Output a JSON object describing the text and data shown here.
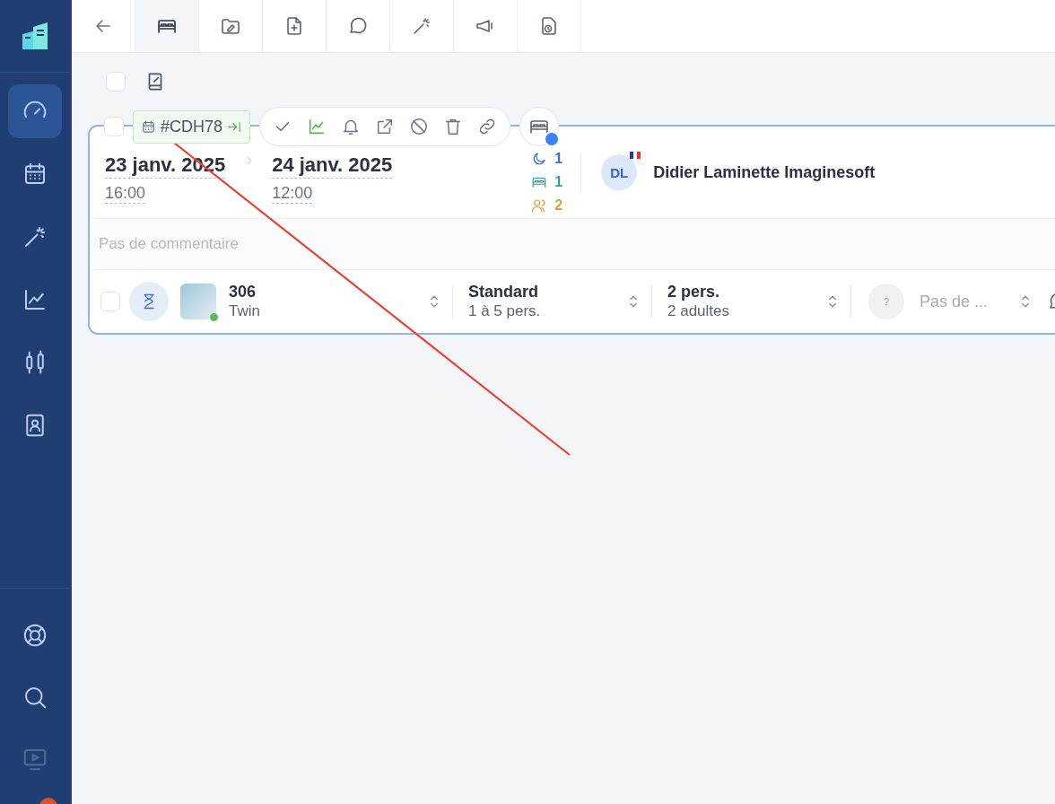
{
  "sidebar": {
    "items": [
      {
        "selected": true,
        "disabled": false
      },
      {
        "selected": false,
        "disabled": false
      },
      {
        "selected": false,
        "disabled": false
      },
      {
        "selected": false,
        "disabled": false
      },
      {
        "selected": false,
        "disabled": false
      },
      {
        "selected": false,
        "disabled": false
      }
    ],
    "bottom_items": [
      {
        "disabled": false
      },
      {
        "disabled": false
      },
      {
        "disabled": true
      }
    ]
  },
  "tabs": [
    {
      "selected": true
    },
    {
      "selected": false
    },
    {
      "selected": false
    },
    {
      "selected": false
    },
    {
      "selected": false
    },
    {
      "selected": false
    },
    {
      "selected": false
    }
  ],
  "toolbar": {
    "select_all_checked": false
  },
  "booking": {
    "checked": false,
    "reference": "#CDH78",
    "arrival": {
      "date": "23 janv. 2025",
      "time": "16:00"
    },
    "departure": {
      "date": "24 janv. 2025",
      "time": "12:00"
    },
    "nights": "1",
    "rooms": "1",
    "guests": "2",
    "guest": {
      "initials": "DL",
      "name": "Didier Laminette Imaginesoft"
    },
    "comment_placeholder": "Pas de commentaire",
    "room": {
      "checked": false,
      "number": "306",
      "type": "Twin",
      "category": "Standard",
      "capacity": "1 à 5 pers.",
      "occupancy": "2 pers.",
      "occupancy_detail": "2 adultes",
      "extra_badge": "?",
      "extra": "Pas de ..."
    }
  }
}
